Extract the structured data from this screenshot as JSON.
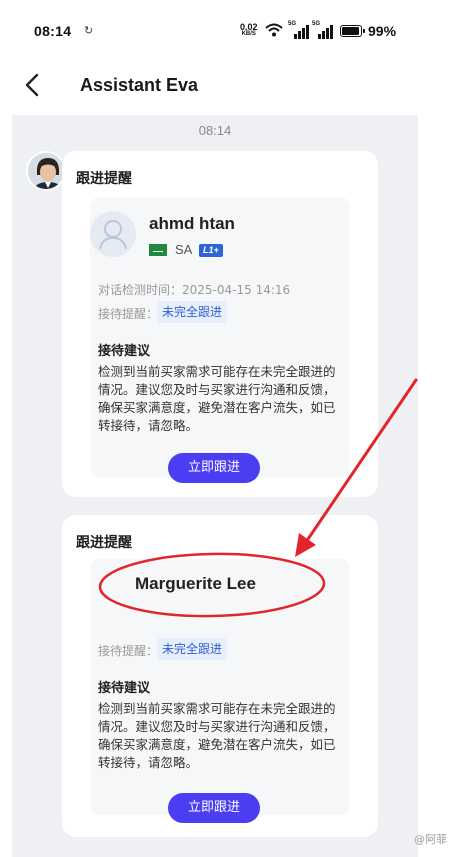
{
  "status_bar": {
    "time": "08:14",
    "speed_value": "0.02",
    "speed_unit": "KB/S",
    "signal_1_label": "5G",
    "signal_2_label": "5G",
    "battery_text": "99%",
    "battery_level": 0.99
  },
  "header": {
    "title": "Assistant Eva",
    "back_icon": "chevron-left-icon"
  },
  "chat": {
    "timestamp": "08:14",
    "bubbles": [
      {
        "title": "跟进提醒",
        "contact_name": "ahmd htan",
        "country": "SA",
        "level": "L1+",
        "detect_label": "对话检测时间：",
        "detect_time": "2025-04-15 14:16",
        "reminder_label": "接待提醒：",
        "status": "未完全跟进",
        "advice_title": "接待建议",
        "advice_text": "检测到当前买家需求可能存在未完全跟进的情况。建议您及时与买家进行沟通和反馈，确保买家满意度，避免潜在客户流失，如已转接待，请忽略。",
        "button_label": "立即跟进"
      },
      {
        "title": "跟进提醒",
        "contact_name": "Marguerite Lee",
        "reminder_label": "接待提醒：",
        "status": "未完全跟进",
        "advice_title": "接待建议",
        "advice_text": "检测到当前买家需求可能存在未完全跟进的情况。建议您及时与买家进行沟通和反馈，确保买家满意度，避免潜在客户流失，如已转接待，请忽略。",
        "button_label": "立即跟进"
      }
    ]
  },
  "watermark": "@阿菲",
  "colors": {
    "accent": "#4a3df2",
    "status_tag_text": "#2f5fcf",
    "annotation": "#e0262b",
    "chat_bg": "#eef0f4"
  }
}
